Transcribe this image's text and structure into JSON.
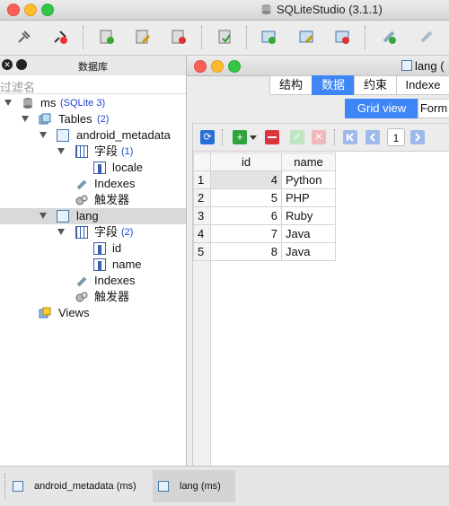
{
  "app": {
    "title": "SQLiteStudio (3.1.1)"
  },
  "left_panel": {
    "title": "数据库",
    "filter_placeholder": "过滤名",
    "tree": {
      "db_name": "ms",
      "db_type": "(SQLite 3)",
      "tables_label": "Tables",
      "tables_count": "(2)",
      "table1": {
        "name": "android_metadata",
        "fields_label": "字段",
        "fields_count": "(1)",
        "fields": [
          "locale"
        ],
        "indexes": "Indexes",
        "triggers": "触发器"
      },
      "table2": {
        "name": "lang",
        "fields_label": "字段",
        "fields_count": "(2)",
        "fields": [
          "id",
          "name"
        ],
        "indexes": "Indexes",
        "triggers": "触发器"
      },
      "views_label": "Views"
    }
  },
  "editor": {
    "window_title": "lang (",
    "tabs": [
      "结构",
      "数据",
      "约束",
      "Indexe"
    ],
    "active_tab": "数据",
    "subtabs": [
      "Grid view",
      "Form"
    ],
    "active_subtab": "Grid view",
    "page_number": "1",
    "columns": [
      "id",
      "name"
    ],
    "rows": [
      {
        "rn": "1",
        "id": "4",
        "name": "Python"
      },
      {
        "rn": "2",
        "id": "5",
        "name": "PHP"
      },
      {
        "rn": "3",
        "id": "6",
        "name": "Ruby"
      },
      {
        "rn": "4",
        "id": "7",
        "name": "Java"
      },
      {
        "rn": "5",
        "id": "8",
        "name": "Java"
      }
    ]
  },
  "taskbar": {
    "items": [
      "android_metadata (ms)",
      "lang (ms)"
    ],
    "active": "lang (ms)"
  }
}
